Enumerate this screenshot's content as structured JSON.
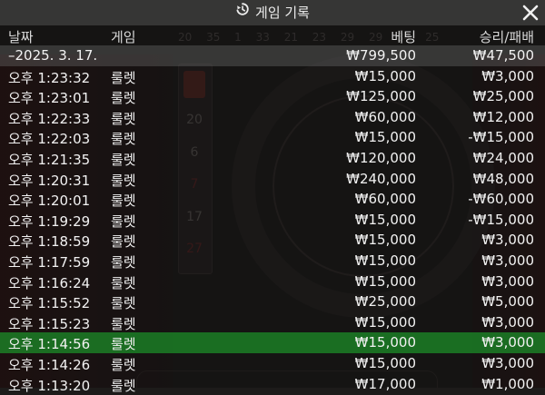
{
  "window": {
    "title": "게임 기록",
    "history_icon": "history-icon",
    "close_icon": "close-icon"
  },
  "columns": {
    "date": "날짜",
    "game": "게임",
    "bet": "베팅",
    "result": "승리/패배"
  },
  "summary": {
    "date": "–2025. 3. 17.",
    "bet": "₩799,500",
    "result": "₩47,500"
  },
  "rows": [
    {
      "time": "오후 1:23:32",
      "game": "룰렛",
      "bet": "₩15,000",
      "result": "₩3,000"
    },
    {
      "time": "오후 1:23:01",
      "game": "룰렛",
      "bet": "₩125,000",
      "result": "₩25,000"
    },
    {
      "time": "오후 1:22:33",
      "game": "룰렛",
      "bet": "₩60,000",
      "result": "₩12,000"
    },
    {
      "time": "오후 1:22:03",
      "game": "룰렛",
      "bet": "₩15,000",
      "result": "-₩15,000"
    },
    {
      "time": "오후 1:21:35",
      "game": "룰렛",
      "bet": "₩120,000",
      "result": "₩24,000"
    },
    {
      "time": "오후 1:20:31",
      "game": "룰렛",
      "bet": "₩240,000",
      "result": "₩48,000"
    },
    {
      "time": "오후 1:20:01",
      "game": "룰렛",
      "bet": "₩60,000",
      "result": "-₩60,000"
    },
    {
      "time": "오후 1:19:29",
      "game": "룰렛",
      "bet": "₩15,000",
      "result": "-₩15,000"
    },
    {
      "time": "오후 1:18:59",
      "game": "룰렛",
      "bet": "₩15,000",
      "result": "₩3,000"
    },
    {
      "time": "오후 1:17:59",
      "game": "룰렛",
      "bet": "₩15,000",
      "result": "₩3,000"
    },
    {
      "time": "오후 1:16:24",
      "game": "룰렛",
      "bet": "₩15,000",
      "result": "₩3,000"
    },
    {
      "time": "오후 1:15:52",
      "game": "룰렛",
      "bet": "₩25,000",
      "result": "₩5,000"
    },
    {
      "time": "오후 1:15:23",
      "game": "룰렛",
      "bet": "₩15,000",
      "result": "₩3,000"
    },
    {
      "time": "오후 1:14:56",
      "game": "룰렛",
      "bet": "₩15,000",
      "result": "₩3,000"
    },
    {
      "time": "오후 1:14:26",
      "game": "룰렛",
      "bet": "₩15,000",
      "result": "₩3,000"
    },
    {
      "time": "오후 1:13:20",
      "game": "룰렛",
      "bet": "₩17,000",
      "result": "₩1,000"
    }
  ],
  "background": {
    "history_numbers": "20 35 1 33 21 23 29 29 34 25",
    "column_numbers": [
      "20",
      "6",
      "7",
      "17",
      "27"
    ]
  },
  "colors": {
    "highlight_row": "#1c8c28",
    "summary_row": "#787878",
    "title_bar": "#3a3a3a"
  }
}
